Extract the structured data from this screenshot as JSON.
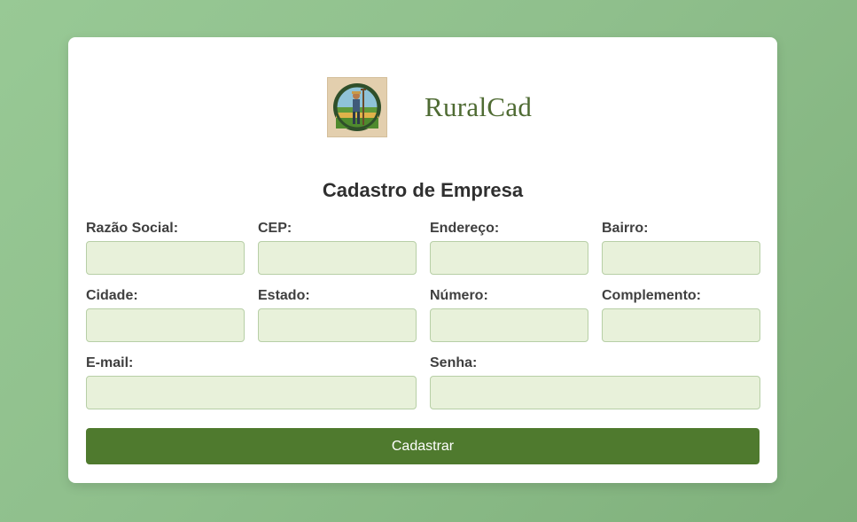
{
  "brand": {
    "name": "RuralCad",
    "logo_icon": "farmer-logo-icon"
  },
  "form": {
    "title": "Cadastro de Empresa",
    "fields": {
      "razao_social": {
        "label": "Razão Social:",
        "value": ""
      },
      "cep": {
        "label": "CEP:",
        "value": ""
      },
      "endereco": {
        "label": "Endereço:",
        "value": ""
      },
      "bairro": {
        "label": "Bairro:",
        "value": ""
      },
      "cidade": {
        "label": "Cidade:",
        "value": ""
      },
      "estado": {
        "label": "Estado:",
        "value": ""
      },
      "numero": {
        "label": "Número:",
        "value": ""
      },
      "complemento": {
        "label": "Complemento:",
        "value": ""
      },
      "email": {
        "label": "E-mail:",
        "value": ""
      },
      "senha": {
        "label": "Senha:",
        "value": ""
      }
    },
    "submit_label": "Cadastrar"
  },
  "colors": {
    "background": "#8fbf8c",
    "accent": "#4f7a2e",
    "input_background": "#e8f1da",
    "brand_text": "#4f6b33"
  }
}
